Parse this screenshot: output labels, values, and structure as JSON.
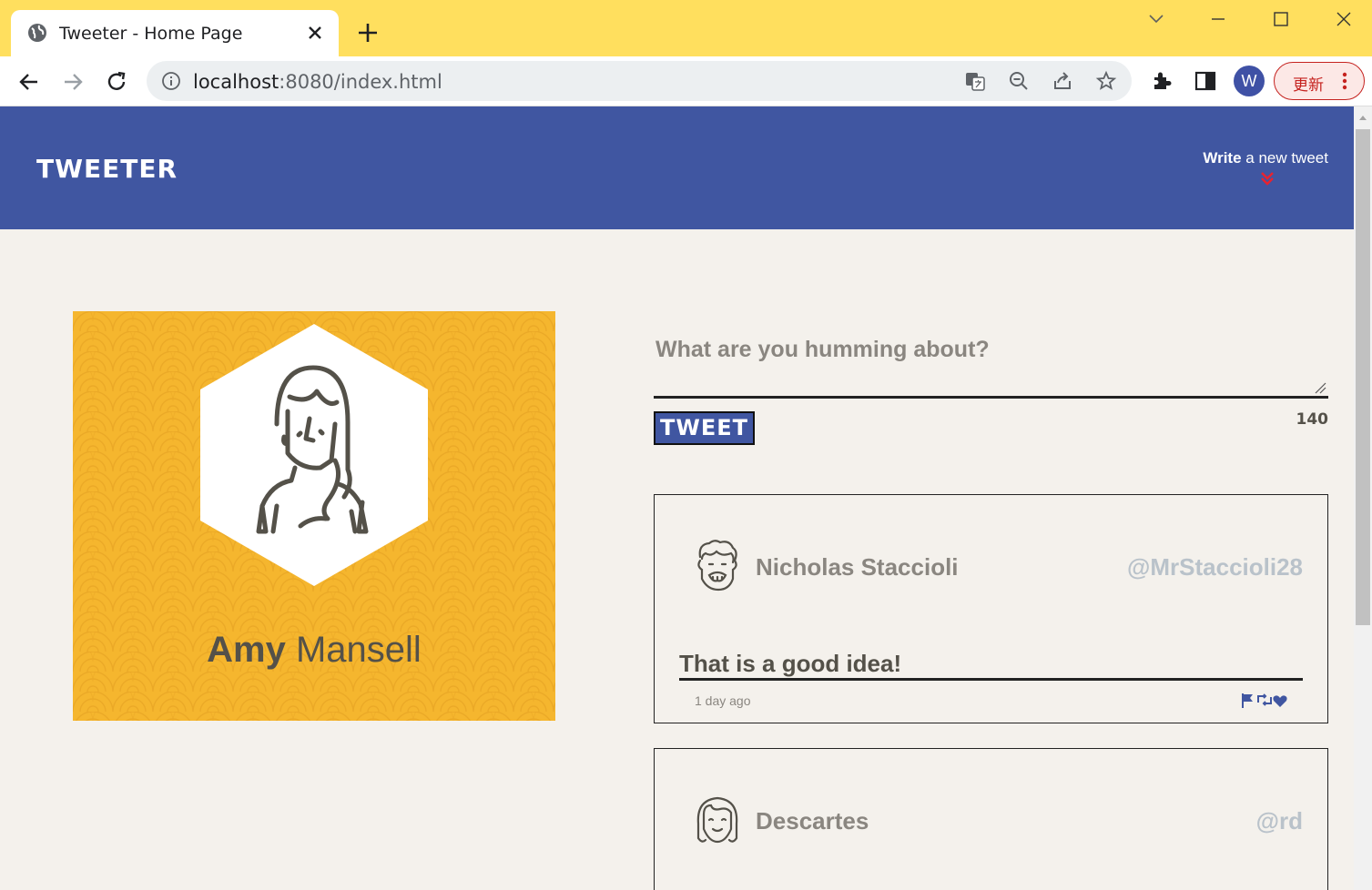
{
  "browser": {
    "tab_title": "Tweeter - Home Page",
    "url_host": "localhost",
    "url_rest": ":8080/index.html",
    "profile_initial": "W",
    "update_label": "更新"
  },
  "header": {
    "logo": "TWEETER",
    "write_bold": "Write",
    "write_rest": " a new tweet"
  },
  "profile": {
    "first_name": "Amy",
    "last_name": "Mansell"
  },
  "compose": {
    "placeholder": "What are you humming about?",
    "button_label": "TWEET",
    "counter": "140"
  },
  "tweets": [
    {
      "name": "Nicholas Staccioli",
      "handle": "@MrStaccioli28",
      "text": "That is a good idea!",
      "time": "1 day ago"
    },
    {
      "name": "Descartes",
      "handle": "@rd",
      "text": "",
      "time": ""
    }
  ],
  "colors": {
    "tabbar": "#ffdf5e",
    "nav": "#4056a1",
    "profile_bg": "#f5b62e",
    "page_bg": "#f4f1ec",
    "accent_red": "#e8222f"
  }
}
